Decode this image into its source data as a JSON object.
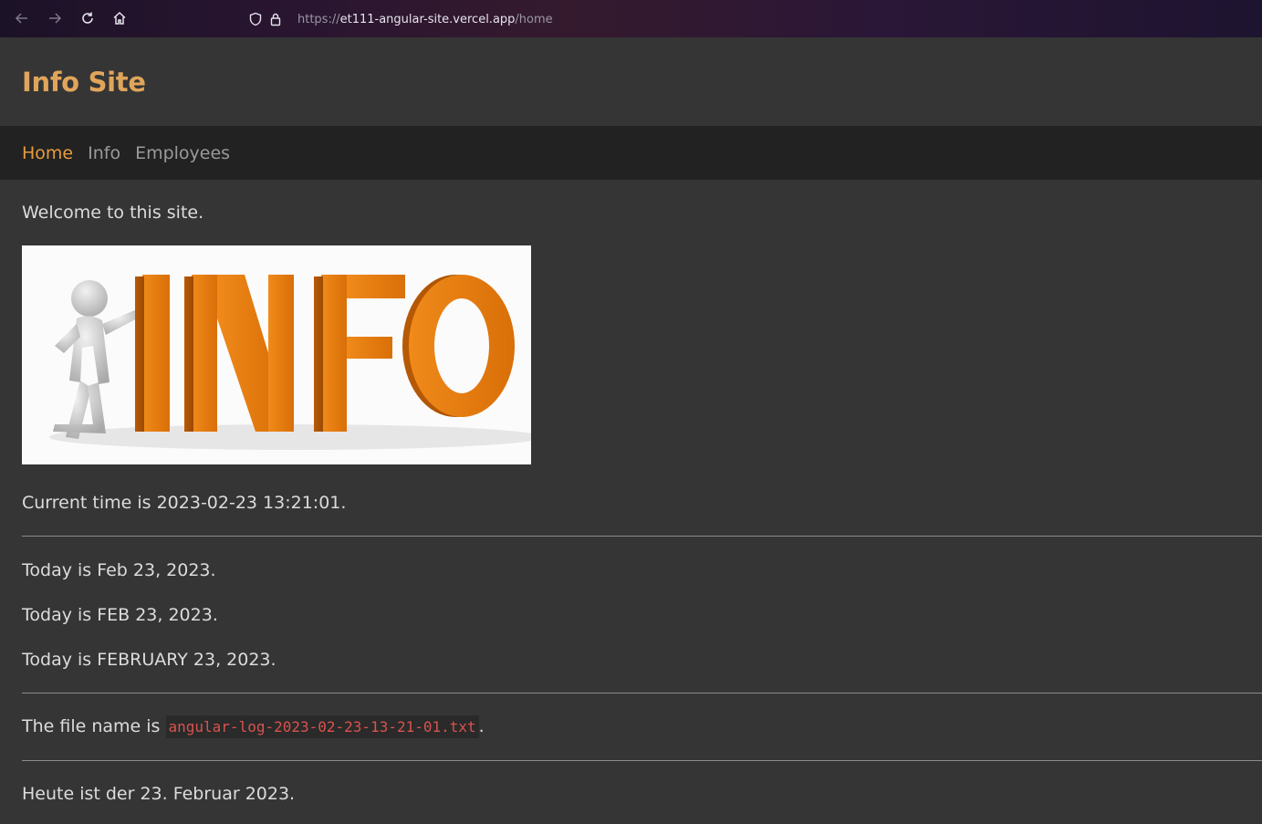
{
  "browser": {
    "url_scheme": "https://",
    "url_host": "et111-angular-site.vercel.app",
    "url_path": "/home"
  },
  "site": {
    "title": "Info Site"
  },
  "nav": {
    "items": [
      {
        "label": "Home",
        "active": true
      },
      {
        "label": "Info",
        "active": false
      },
      {
        "label": "Employees",
        "active": false
      }
    ]
  },
  "main": {
    "welcome": "Welcome to this site.",
    "image_word": "INFO",
    "current_time": "Current time is 2023-02-23 13:21:01.",
    "dates": [
      "Today is Feb 23, 2023.",
      "Today is FEB 23, 2023.",
      "Today is FEBRUARY 23, 2023."
    ],
    "file_prefix": "The file name is ",
    "file_name": "angular-log-2023-02-23-13-21-01.txt",
    "file_suffix": ".",
    "german_date": "Heute ist der 23. Februar 2023."
  },
  "colors": {
    "accent": "#e0a55b",
    "active_nav": "#e89b3c",
    "background": "#353535",
    "nav_bg": "#222222",
    "code_text": "#d9534f",
    "info_orange": "#e07a10"
  }
}
